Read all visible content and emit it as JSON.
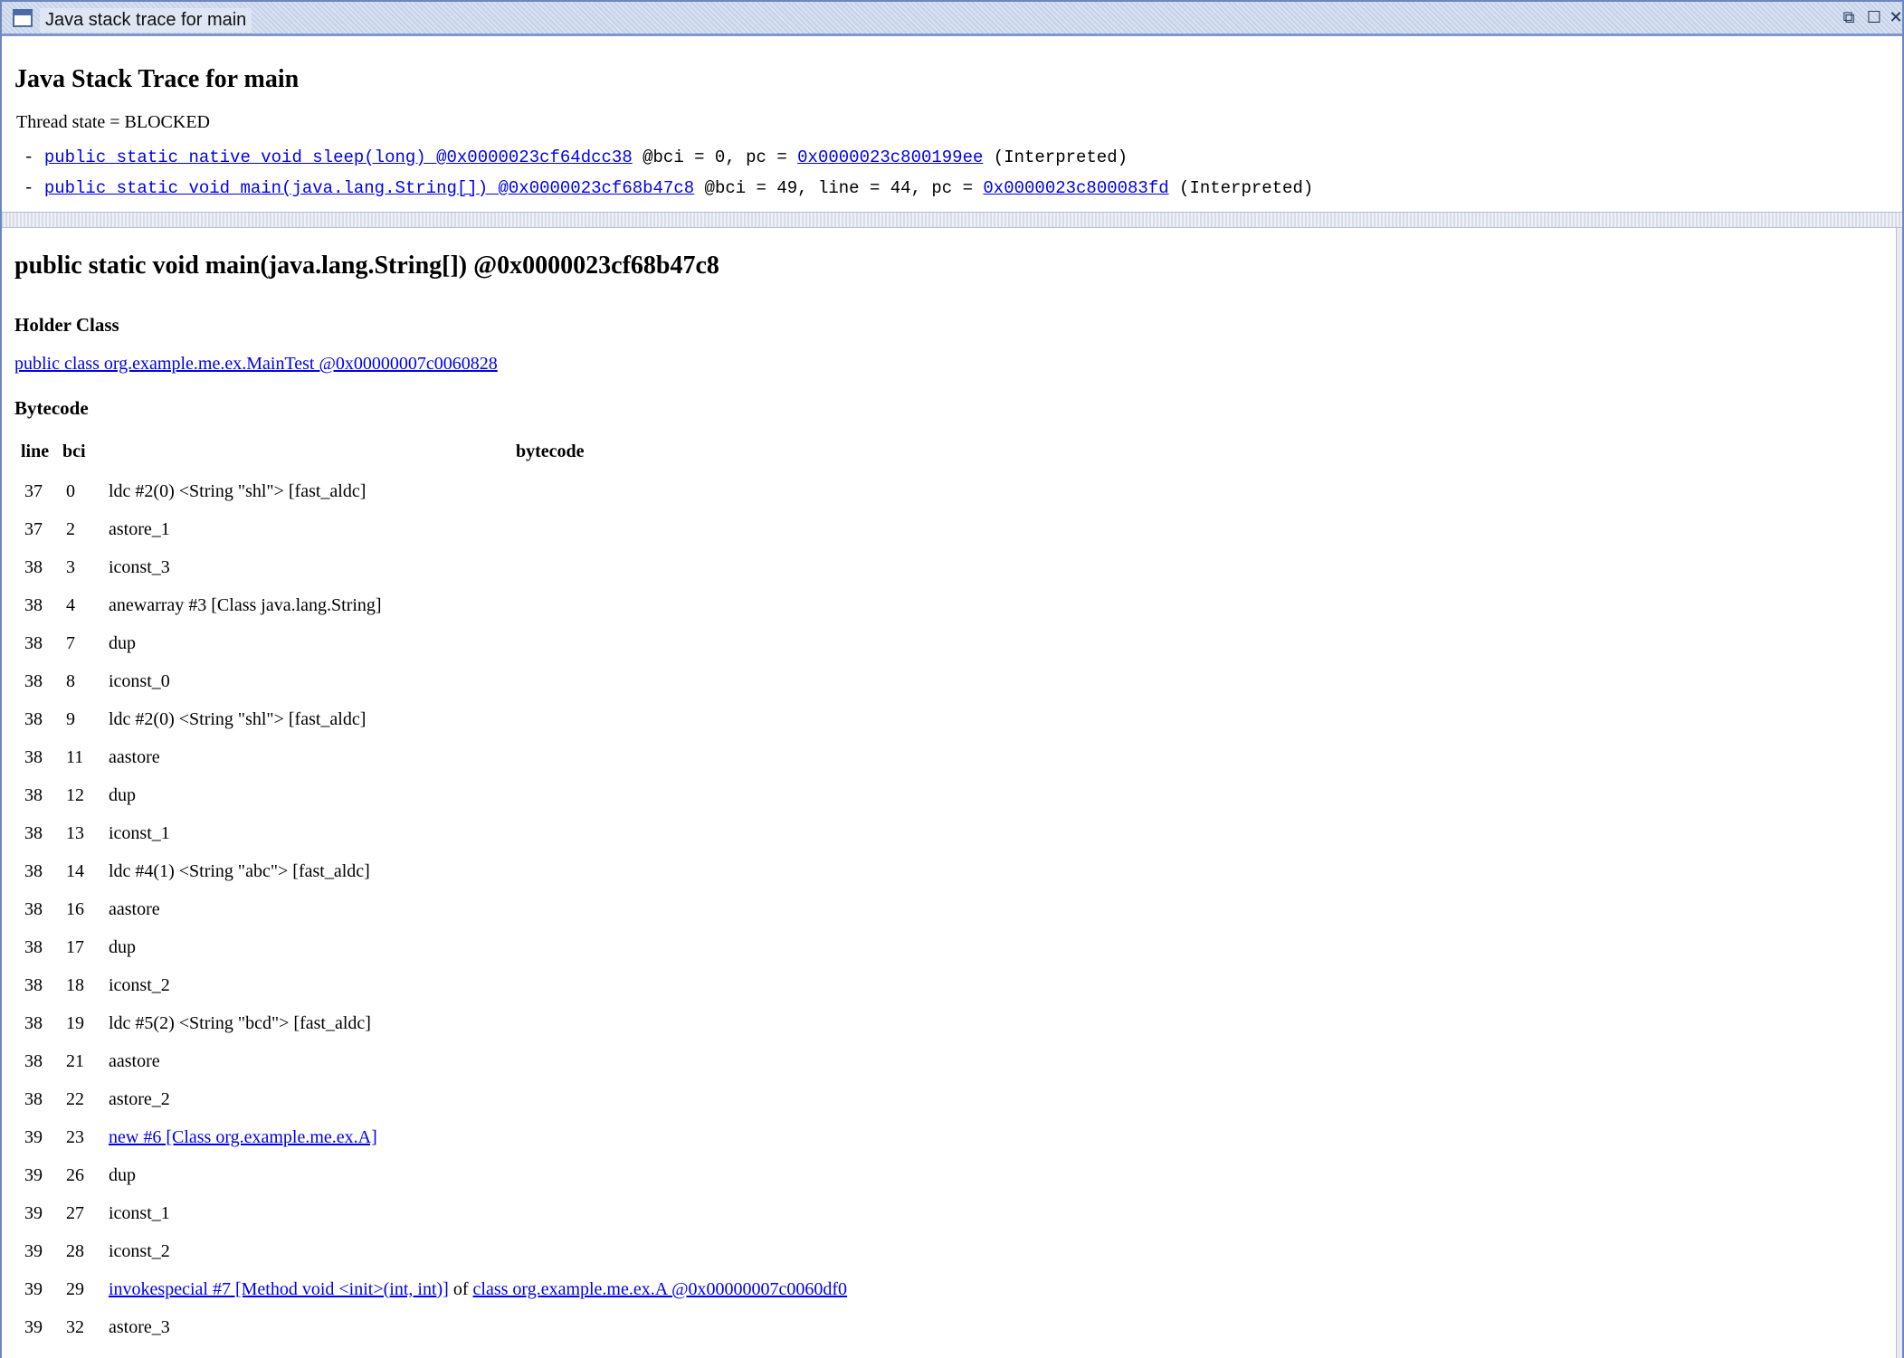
{
  "window": {
    "title": "Java stack trace for main",
    "controls": [
      "restore",
      "maximize",
      "close"
    ]
  },
  "stack_trace": {
    "heading": "Java Stack Trace for main",
    "thread_state": "Thread state = BLOCKED",
    "frames": [
      {
        "prefix": "- ",
        "method": "public static native void sleep(long) @0x0000023cf64dcc38",
        "mid": " @bci = 0, pc = ",
        "pc": "0x0000023c800199ee",
        "suffix": " (Interpreted)"
      },
      {
        "prefix": "- ",
        "method": "public static void main(java.lang.String[]) @0x0000023cf68b47c8",
        "mid": " @bci = 49, line = 44, pc = ",
        "pc": "0x0000023c800083fd",
        "suffix": " (Interpreted)"
      }
    ]
  },
  "detail": {
    "method_title": "public static void main(java.lang.String[]) @0x0000023cf68b47c8",
    "holder_label": "Holder Class",
    "holder_link": "public class org.example.me.ex.MainTest @0x00000007c0060828",
    "bytecode_label": "Bytecode",
    "columns": [
      "line",
      "bci",
      "bytecode"
    ],
    "rows": [
      {
        "line": "37",
        "bci": "0",
        "code": "ldc #2(0) <String \"shl\"> [fast_aldc]"
      },
      {
        "line": "37",
        "bci": "2",
        "code": "astore_1"
      },
      {
        "line": "38",
        "bci": "3",
        "code": "iconst_3"
      },
      {
        "line": "38",
        "bci": "4",
        "code": "anewarray #3 [Class java.lang.String]"
      },
      {
        "line": "38",
        "bci": "7",
        "code": "dup"
      },
      {
        "line": "38",
        "bci": "8",
        "code": "iconst_0"
      },
      {
        "line": "38",
        "bci": "9",
        "code": "ldc #2(0) <String \"shl\"> [fast_aldc]"
      },
      {
        "line": "38",
        "bci": "11",
        "code": "aastore"
      },
      {
        "line": "38",
        "bci": "12",
        "code": "dup"
      },
      {
        "line": "38",
        "bci": "13",
        "code": "iconst_1"
      },
      {
        "line": "38",
        "bci": "14",
        "code": "ldc #4(1) <String \"abc\"> [fast_aldc]"
      },
      {
        "line": "38",
        "bci": "16",
        "code": "aastore"
      },
      {
        "line": "38",
        "bci": "17",
        "code": "dup"
      },
      {
        "line": "38",
        "bci": "18",
        "code": "iconst_2"
      },
      {
        "line": "38",
        "bci": "19",
        "code": "ldc #5(2) <String \"bcd\"> [fast_aldc]"
      },
      {
        "line": "38",
        "bci": "21",
        "code": "aastore"
      },
      {
        "line": "38",
        "bci": "22",
        "code": "astore_2"
      },
      {
        "line": "39",
        "bci": "23",
        "code_link": "new #6 [Class org.example.me.ex.A]"
      },
      {
        "line": "39",
        "bci": "26",
        "code": "dup"
      },
      {
        "line": "39",
        "bci": "27",
        "code": "iconst_1"
      },
      {
        "line": "39",
        "bci": "28",
        "code": "iconst_2"
      },
      {
        "line": "39",
        "bci": "29",
        "code_link": "invokespecial #7 [Method void <init>(int, int)]",
        "code_mid": " of ",
        "code_link2": "class org.example.me.ex.A @0x00000007c0060df0"
      },
      {
        "line": "39",
        "bci": "32",
        "code": "astore_3"
      }
    ]
  }
}
